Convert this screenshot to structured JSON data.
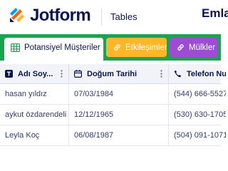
{
  "header": {
    "brand": "Jotform",
    "product": "Tables",
    "user_name": "Emla"
  },
  "tabs": {
    "active_tab": {
      "label": "Potansiyel Müşteriler",
      "menu": "•••"
    },
    "buttons": [
      {
        "label": "Etkileşimler",
        "color": "#ffb629",
        "icon": "link-icon"
      },
      {
        "label": "Mülkler",
        "color": "#9c4dd3",
        "icon": "link-icon"
      }
    ]
  },
  "table": {
    "columns": [
      {
        "label": "Adı Soy...",
        "icon": "text-type-icon"
      },
      {
        "label": "Doğum Tarihi",
        "icon": "calendar-icon"
      },
      {
        "label": "Telefon Nu",
        "icon": "phone-icon"
      }
    ],
    "rows": [
      [
        "hasan yıldız",
        "07/03/1984",
        "(544) 666-5527"
      ],
      [
        "aykut özdarendeli",
        "12/12/1965",
        "(530) 630-1705"
      ],
      [
        "Leyla Koç",
        "06/08/1987",
        "(504) 091-1071"
      ]
    ]
  },
  "colors": {
    "tabbar_green": "#1ba34f",
    "navy": "#0a1551"
  }
}
